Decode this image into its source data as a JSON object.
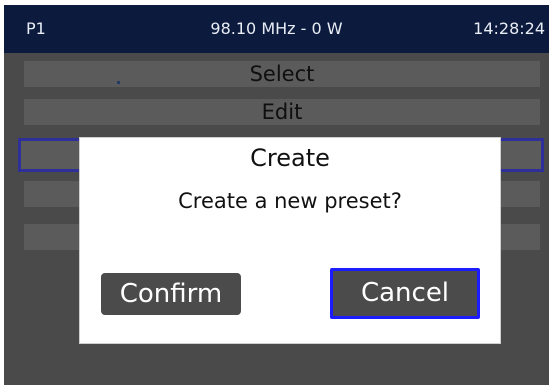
{
  "status_bar": {
    "preset": "P1",
    "frequency_power": "98.10 MHz - 0 W",
    "time": "14:28:24"
  },
  "menu": {
    "items": [
      {
        "label": "Select"
      },
      {
        "label": "Edit"
      },
      {
        "label": ""
      },
      {
        "label": ""
      },
      {
        "label": ""
      }
    ],
    "selected_index": 2
  },
  "dialog": {
    "title": "Create",
    "message": "Create a new preset?",
    "confirm_label": "Confirm",
    "cancel_label": "Cancel",
    "focused_button": "cancel"
  },
  "colors": {
    "status_bar_bg": "#0b1a3d",
    "screen_bg": "#4a4a4a",
    "focus_border": "#1c1cff",
    "button_bg": "#4b4b4b"
  }
}
